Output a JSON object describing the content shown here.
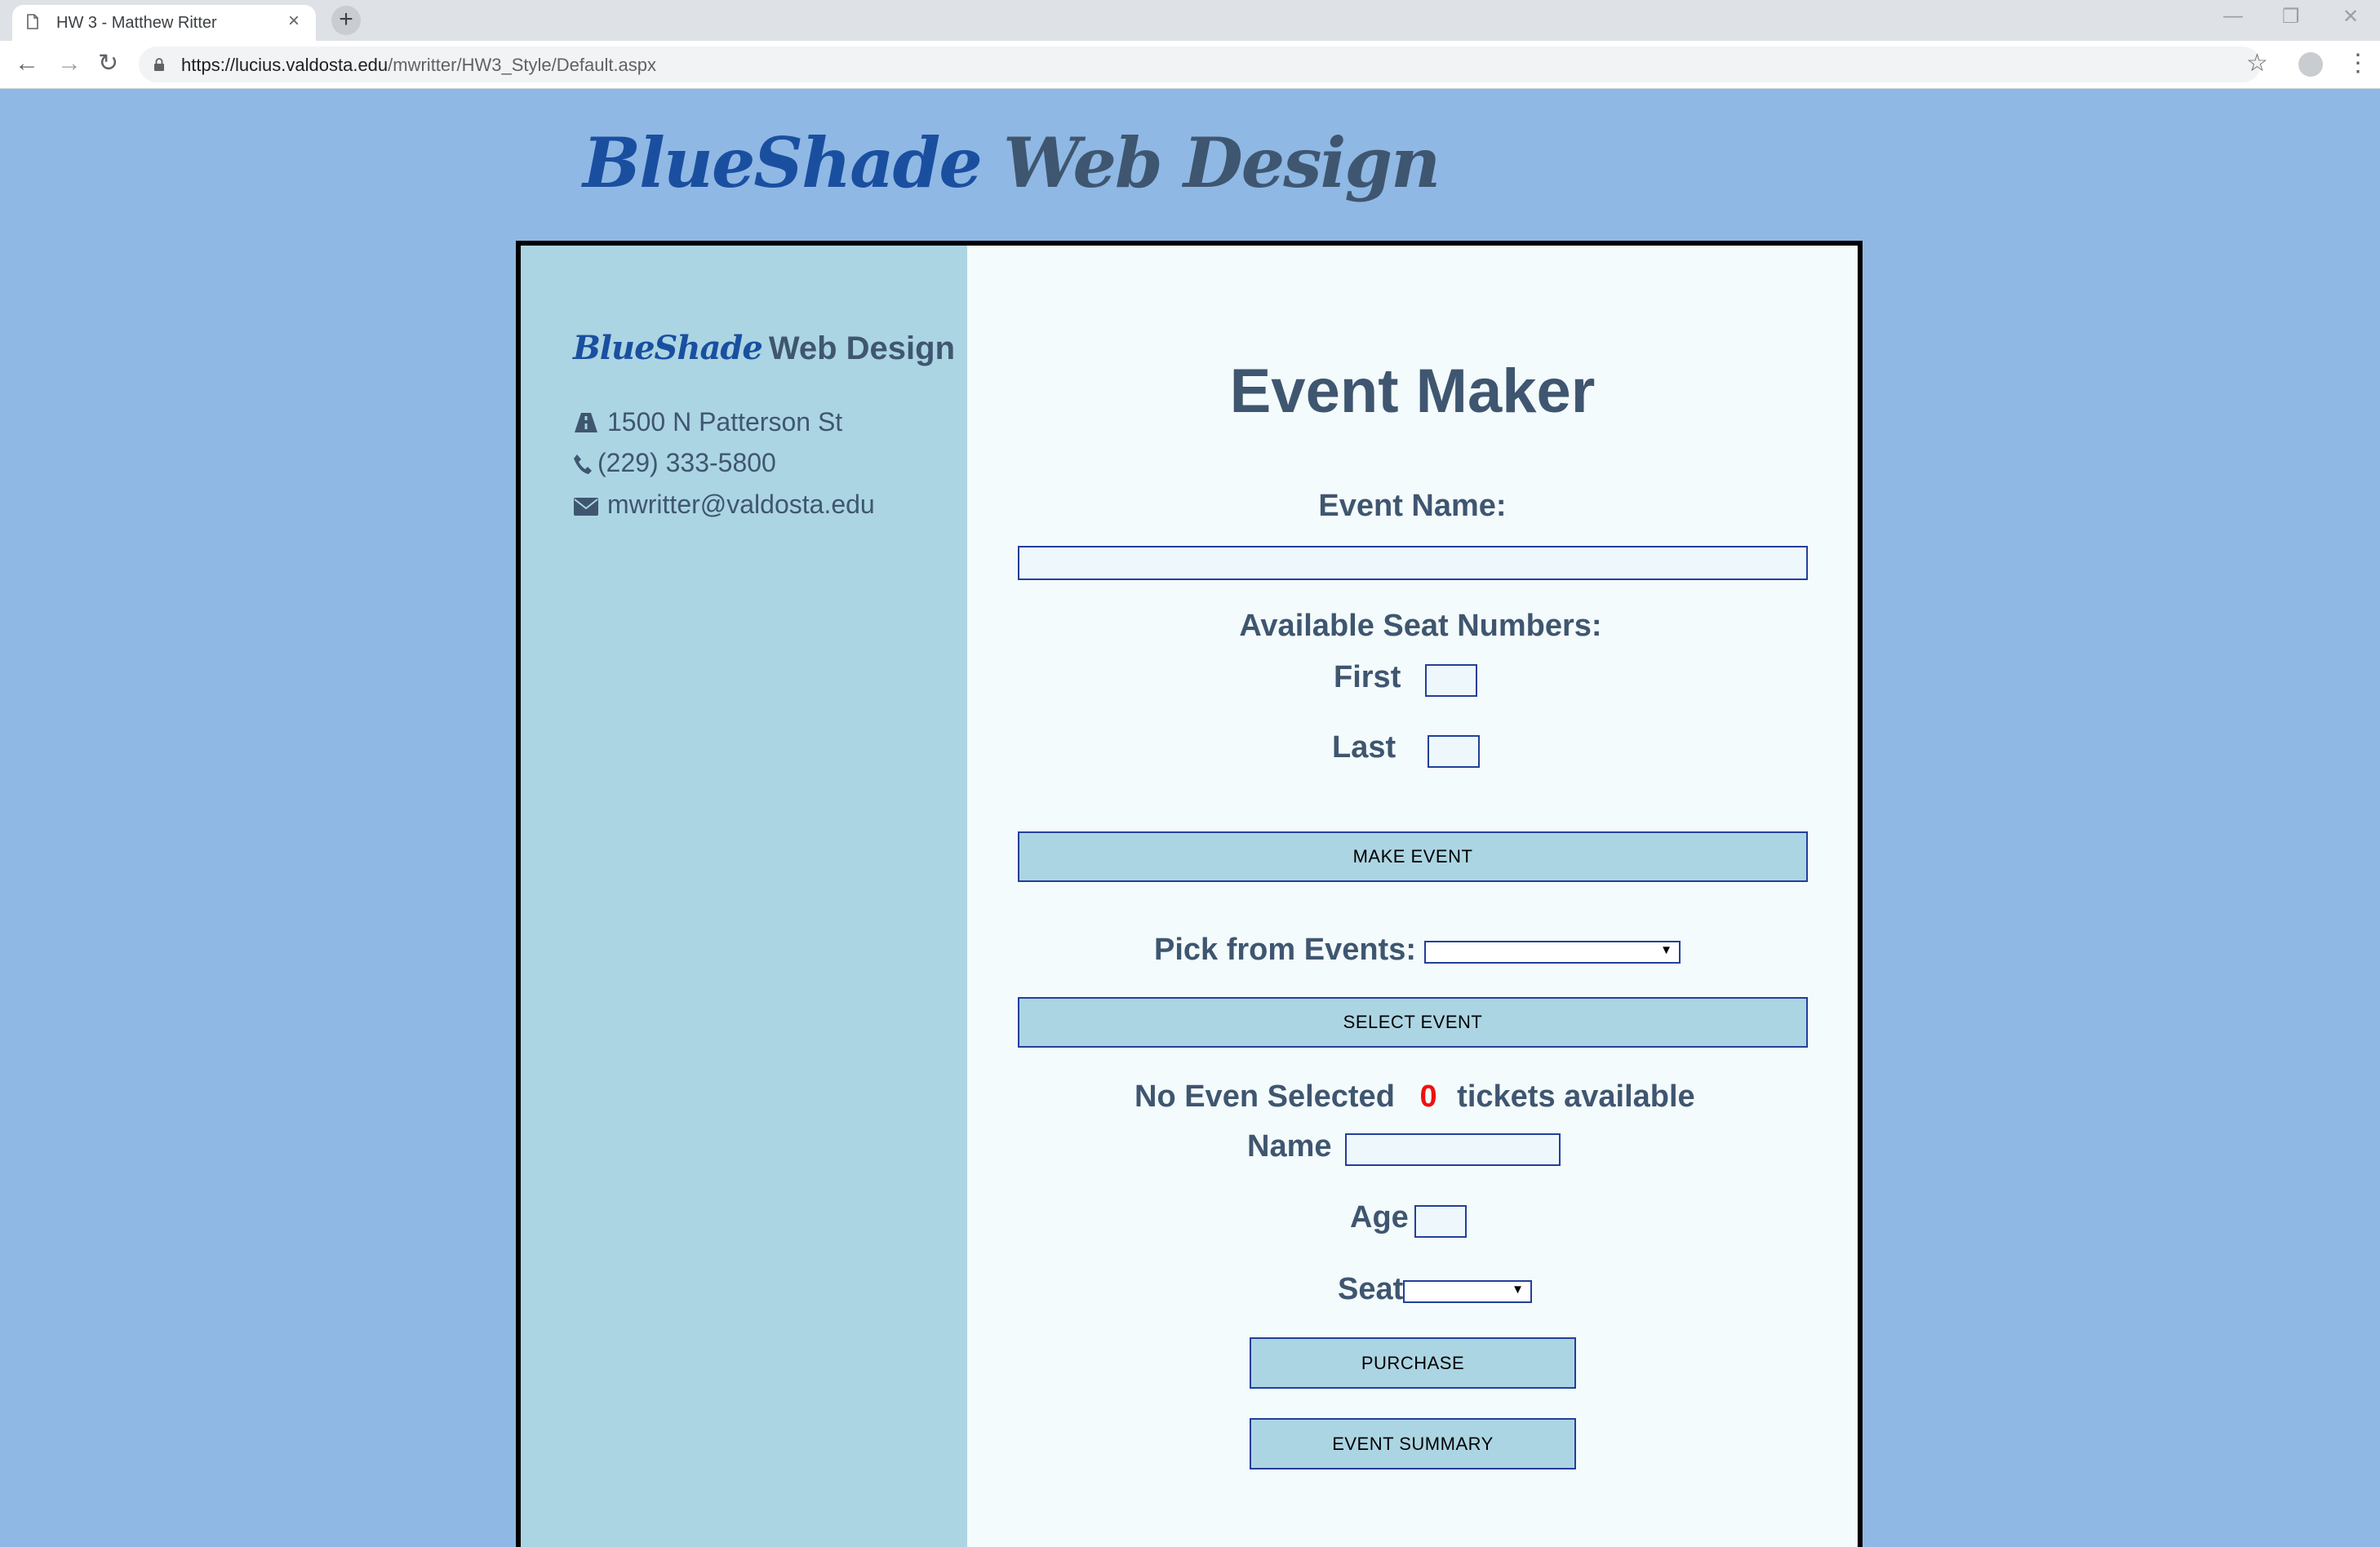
{
  "browser": {
    "tab_title": "HW 3 - Matthew Ritter",
    "tab_close": "×",
    "new_tab": "+",
    "url_host": "https://lucius.valdosta.edu",
    "url_path": "/mwritter/HW3_Style/Default.aspx"
  },
  "header": {
    "logo_part1": "BlueShade",
    "logo_part2": "Web Design"
  },
  "sidebar": {
    "logo_part1": "BlueShade",
    "logo_part2": "Web Design",
    "address": "1500 N Patterson St",
    "phone": "(229) 333-5800",
    "email": "mwritter@valdosta.edu"
  },
  "main": {
    "title": "Event Maker",
    "event_name_label": "Event Name:",
    "event_name_value": "",
    "seat_numbers_label": "Available Seat Numbers:",
    "first_label": "First",
    "first_value": "",
    "last_label": "Last",
    "last_value": "",
    "make_event_button": "MAKE EVENT",
    "pick_label": "Pick from Events:",
    "pick_value": "",
    "select_event_button": "SELECT EVENT",
    "status_text": "No Even Selected",
    "tickets_count": "0",
    "tickets_text": "tickets available",
    "name_label": "Name",
    "name_value": "",
    "age_label": "Age",
    "age_value": "",
    "seat_label": "Seat",
    "seat_value": "",
    "purchase_button": "PURCHASE",
    "summary_button": "EVENT SUMMARY"
  },
  "colors": {
    "page_bg": "#8fb8e4",
    "sidebar_bg": "#acd5e3",
    "main_bg": "#f4fbfc",
    "brand_blue": "#1a4fa0",
    "text_slate": "#3f5670",
    "count_red": "#ee1111"
  }
}
